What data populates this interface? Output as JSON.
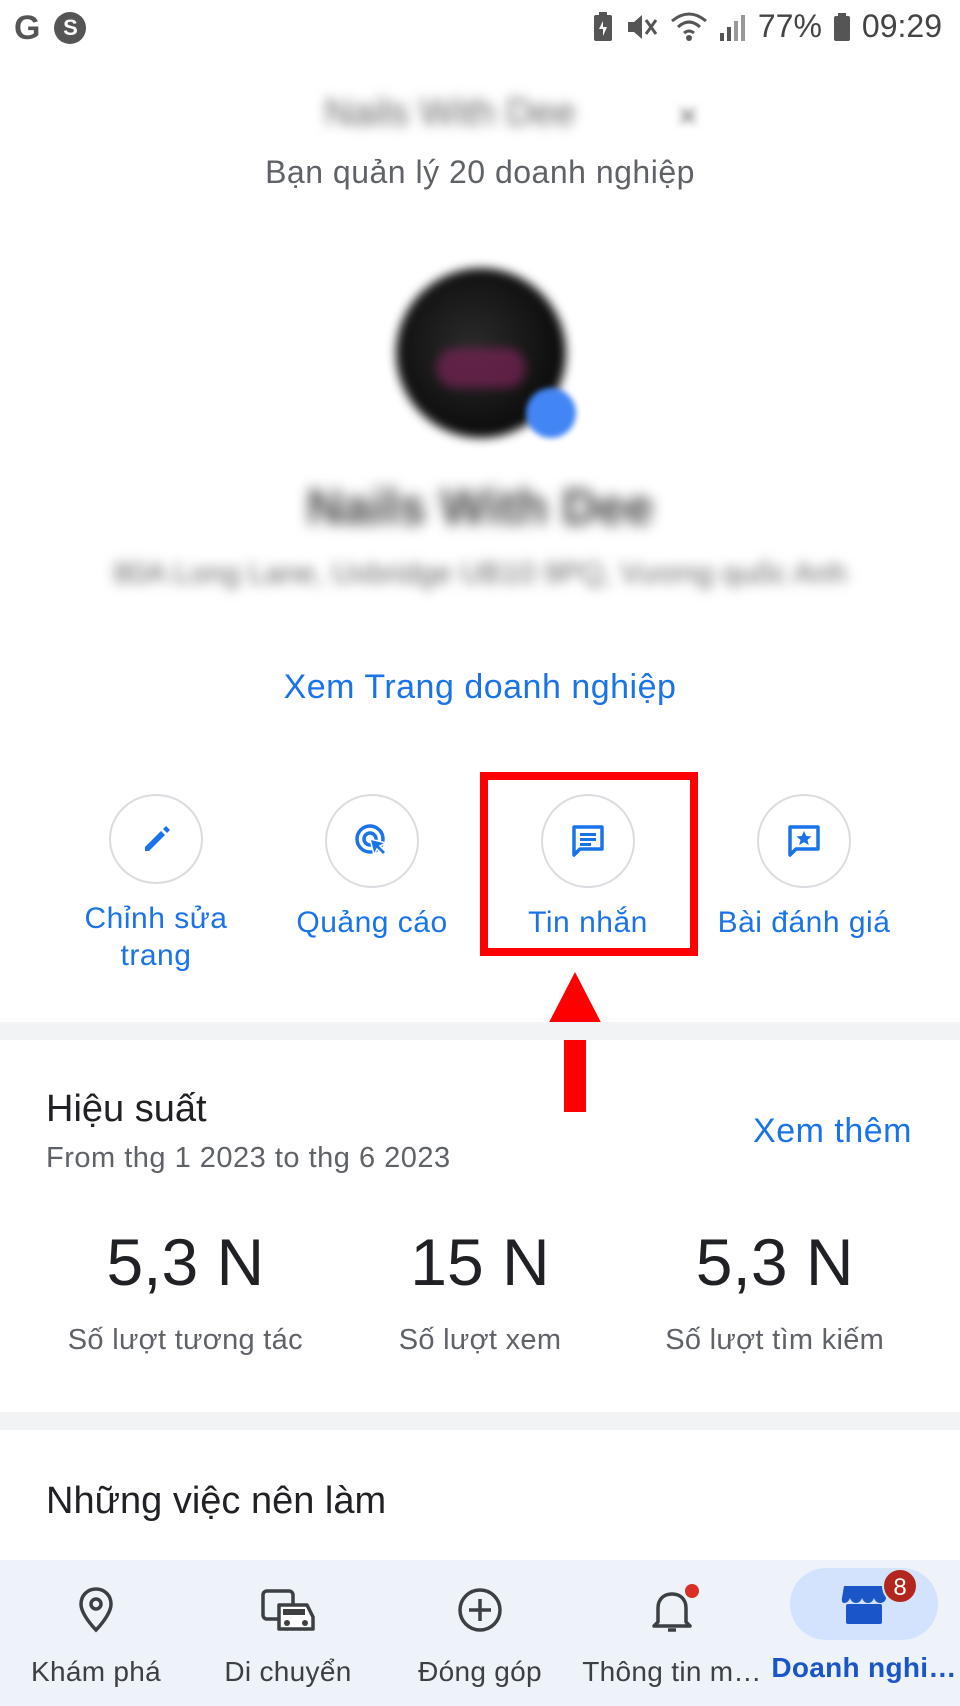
{
  "status_bar": {
    "left_icons": [
      "google-icon",
      "shazam-icon"
    ],
    "left_g": "G",
    "left_s": "S",
    "battery_percent": "77%",
    "time": "09:29"
  },
  "account": {
    "name": "Nails With Dee",
    "managed_text": "Bạn quản lý 20 doanh nghiệp"
  },
  "business": {
    "name": "Nails With Dee",
    "address": "80A Long Lane, Uxbridge UB10 9PQ, Vương quốc Anh",
    "view_page_link": "Xem Trang doanh nghiệp"
  },
  "actions": [
    {
      "label": "Chỉnh sửa trang",
      "icon": "pencil-icon"
    },
    {
      "label": "Quảng cáo",
      "icon": "ads-icon"
    },
    {
      "label": "Tin nhắn",
      "icon": "message-icon"
    },
    {
      "label": "Bài đánh giá",
      "icon": "review-star-icon"
    }
  ],
  "performance": {
    "title": "Hiệu suất",
    "range": "From thg 1 2023 to thg 6 2023",
    "see_more": "Xem thêm",
    "stats": [
      {
        "value": "5,3 N",
        "label": "Số lượt tương tác"
      },
      {
        "value": "15 N",
        "label": "Số lượt xem"
      },
      {
        "value": "5,3 N",
        "label": "Số lượt tìm kiếm"
      }
    ]
  },
  "todo": {
    "title": "Những việc nên làm"
  },
  "bottom_nav": [
    {
      "label": "Khám phá",
      "icon": "location-pin-icon"
    },
    {
      "label": "Di chuyển",
      "icon": "commute-icon"
    },
    {
      "label": "Đóng góp",
      "icon": "add-circle-icon"
    },
    {
      "label": "Thông tin m…",
      "icon": "bell-icon"
    },
    {
      "label": "Doanh nghi…",
      "icon": "storefront-icon",
      "badge": "8",
      "active": true
    }
  ],
  "colors": {
    "accent": "#1a73e8",
    "highlight": "#ff0000",
    "badge": "#b3261e"
  }
}
